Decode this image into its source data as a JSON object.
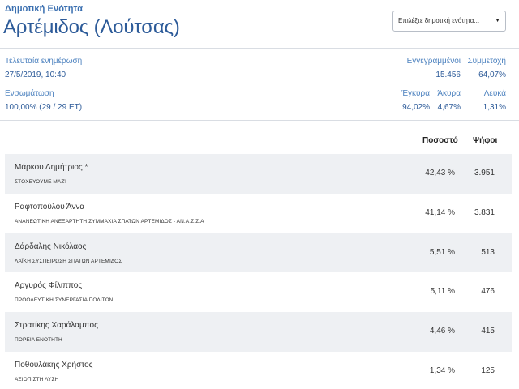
{
  "header": {
    "subtitle": "Δημοτική Ενότητα",
    "title": "Αρτέμιδος (Λούτσας)",
    "select_value": "Επιλέξτε δημοτική ενότητα..."
  },
  "stats": {
    "last_update_label": "Τελευταία ενημέρωση",
    "last_update_value": "27/5/2019, 10:40",
    "integration_label": "Ενσωμάτωση",
    "integration_value": "100,00% (29 / 29 ΕΤ)",
    "registered_label": "Εγγεγραμμένοι",
    "registered_value": "15.456",
    "turnout_label": "Συμμετοχή",
    "turnout_value": "64,07%",
    "valid_label": "Έγκυρα",
    "valid_value": "94,02%",
    "invalid_label": "Άκυρα",
    "invalid_value": "4,67%",
    "blank_label": "Λευκά",
    "blank_value": "1,31%"
  },
  "table": {
    "col_percent": "Ποσοστό",
    "col_votes": "Ψήφοι",
    "rows": [
      {
        "name": "Μάρκου Δημήτριος *",
        "party": "ΣΤΟΧΕΥΟΥΜΕ μαζί",
        "percent": "42,43 %",
        "votes": "3.951"
      },
      {
        "name": "Ραφτοπούλου Άννα",
        "party": "ΑΝΑΝΕΩΤΙΚΗ ΑΝΕΞΑΡΤΗΤΗ ΣΥΜΜΑΧΙΑ ΣΠΑΤΩΝ ΑΡΤΕΜΙΔΟΣ - ΑΝ.Α.Σ.Σ.Α",
        "percent": "41,14 %",
        "votes": "3.831"
      },
      {
        "name": "Δάρδαλης Νικόλαος",
        "party": "ΛΑΪΚΗ ΣΥΣΠΕΙΡΩΣΗ ΣΠΑΤΩΝ ΑΡΤΕΜΙΔΟΣ",
        "percent": "5,51 %",
        "votes": "513"
      },
      {
        "name": "Αργυρός Φίλιππος",
        "party": "ΠΡΟΟΔΕΥΤΙΚΗ ΣΥΝΕΡΓΑΣΙΑ ΠΟΛΙΤΩΝ",
        "percent": "5,11 %",
        "votes": "476"
      },
      {
        "name": "Στρατίκης Χαράλαμπος",
        "party": "ΠΟΡΕΙΑ ΕΝΟΤΗΤΗ",
        "percent": "4,46 %",
        "votes": "415"
      },
      {
        "name": "Ποθουλάκης Χρήστος",
        "party": "ΑΞΙΟΠΙΣΤΗ ΛΥΣΗ",
        "percent": "1,34 %",
        "votes": "125"
      }
    ]
  }
}
